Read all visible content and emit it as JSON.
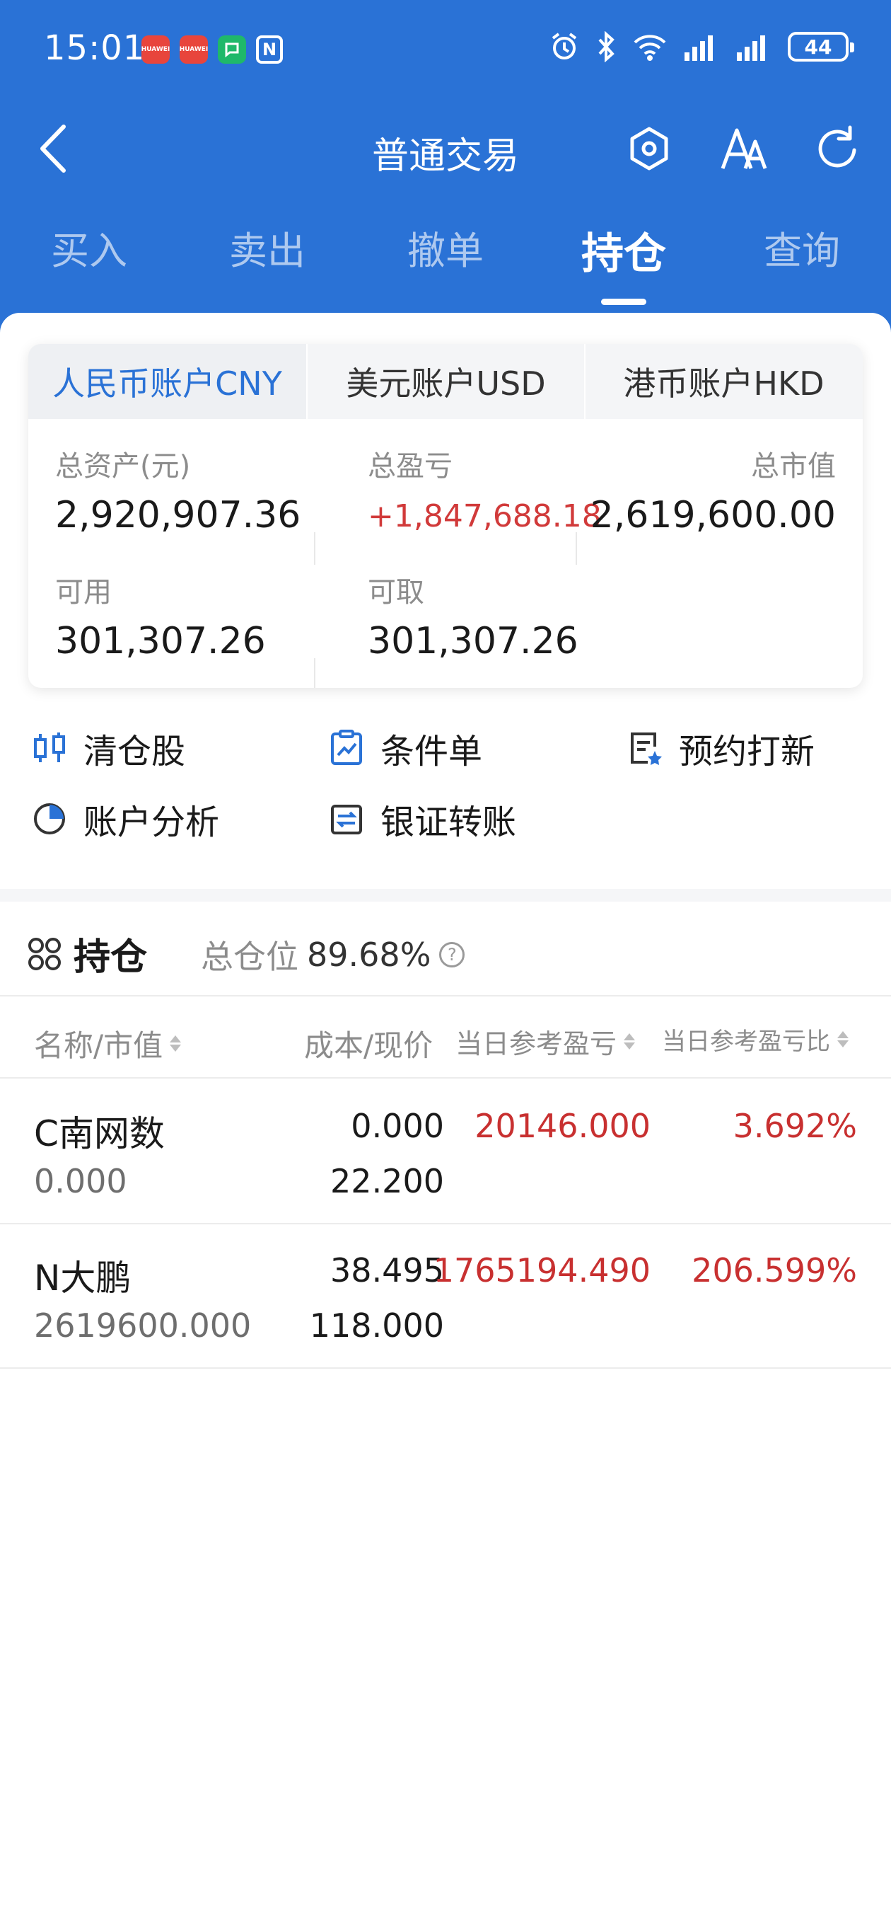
{
  "status": {
    "time": "15:01",
    "notif_apps": [
      "HUAWEI",
      "HUAWEI",
      "",
      "N"
    ],
    "battery": "44"
  },
  "nav": {
    "title": "普通交易",
    "icons": [
      "back-chevron-icon",
      "hexagon-settings-icon",
      "font-size-icon",
      "refresh-icon"
    ]
  },
  "main_tabs": [
    "买入",
    "卖出",
    "撤单",
    "持仓",
    "查询"
  ],
  "main_tab_active": "持仓",
  "accounts": {
    "tabs": [
      "人民币账户CNY",
      "美元账户USD",
      "港币账户HKD"
    ],
    "active": "人民币账户CNY",
    "metrics": {
      "total_assets_label": "总资产(元)",
      "total_assets": "2,920,907.36",
      "total_pl_label": "总盈亏",
      "total_pl": "+1,847,688.18",
      "market_value_label": "总市值",
      "market_value": "2,619,600.00",
      "available_label": "可用",
      "available": "301,307.26",
      "withdrawable_label": "可取",
      "withdrawable": "301,307.26"
    }
  },
  "quick_actions": [
    {
      "label": "清仓股",
      "icon": "clear-stock-icon"
    },
    {
      "label": "条件单",
      "icon": "conditional-order-icon"
    },
    {
      "label": "预约打新",
      "icon": "ipo-reserve-icon"
    },
    {
      "label": "账户分析",
      "icon": "pie-chart-icon"
    },
    {
      "label": "银证转账",
      "icon": "bank-transfer-icon"
    }
  ],
  "holdings": {
    "title": "持仓",
    "ratio_label": "总仓位",
    "ratio_value": "89.68%",
    "columns": [
      "名称/市值",
      "成本/现价",
      "当日参考盈亏",
      "当日参考盈亏比"
    ],
    "rows": [
      {
        "name": "C南网数",
        "market_value": "0.000",
        "cost": "0.000",
        "price": "22.200",
        "day_pl": "20146.000",
        "day_pl_ratio": "3.692%"
      },
      {
        "name": "N大鹏",
        "market_value": "2619600.000",
        "cost": "38.495",
        "price": "118.000",
        "day_pl": "1765194.490",
        "day_pl_ratio": "206.599%"
      }
    ]
  },
  "colors": {
    "header_blue": "#2a72d6",
    "gain_red": "#c83030",
    "muted": "#8c8c8c"
  }
}
